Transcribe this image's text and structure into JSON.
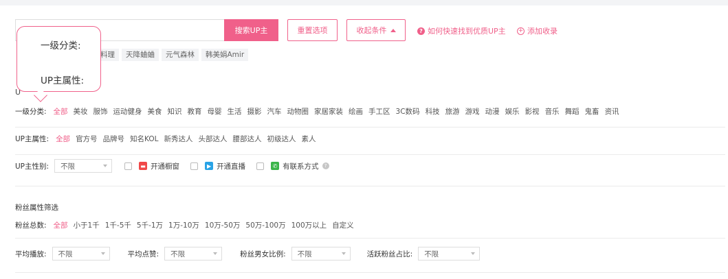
{
  "search": {
    "placeholder": "",
    "button_label": "搜索UP主",
    "reset_label": "重置选项",
    "collapse_label": "收起条件",
    "help_link": "如何快速找到优质UP主",
    "add_link": "添加收录",
    "tags": [
      "料理",
      "天降蛐蛐",
      "元气森林",
      "韩美娟Amir"
    ]
  },
  "tooltip": {
    "line1": "一级分类:",
    "line2": "UP主属性:"
  },
  "up_section_label": "U",
  "categories": {
    "label": "一级分类:",
    "options": [
      "全部",
      "美妆",
      "服饰",
      "运动健身",
      "美食",
      "知识",
      "教育",
      "母婴",
      "生活",
      "摄影",
      "汽车",
      "动物圈",
      "家居家装",
      "绘画",
      "手工区",
      "3C数码",
      "科技",
      "旅游",
      "游戏",
      "动漫",
      "娱乐",
      "影视",
      "音乐",
      "舞蹈",
      "鬼畜",
      "资讯"
    ],
    "active_index": 0
  },
  "attributes": {
    "label": "UP主属性:",
    "options": [
      "全部",
      "官方号",
      "品牌号",
      "知名KOL",
      "新秀达人",
      "头部达人",
      "腰部达人",
      "初级达人",
      "素人"
    ],
    "active_index": 0
  },
  "gender": {
    "label": "UP主性别:",
    "select_value": "不限",
    "checks": [
      "开通橱窗",
      "开通直播",
      "有联系方式"
    ]
  },
  "fans_section": {
    "title": "粉丝属性筛选"
  },
  "fans_total": {
    "label": "粉丝总数:",
    "options": [
      "全部",
      "小于1千",
      "1千-5千",
      "5千-1万",
      "1万-10万",
      "10万-50万",
      "50万-100万",
      "100万以上",
      "自定义"
    ],
    "active_index": 0
  },
  "stats": {
    "avg_play_label": "平均播放:",
    "avg_play_value": "不限",
    "avg_like_label": "平均点赞:",
    "avg_like_value": "不限",
    "gender_ratio_label": "粉丝男女比例:",
    "gender_ratio_value": "不限",
    "active_ratio_label": "活跃粉丝占比:",
    "active_ratio_value": "不限"
  },
  "colors": {
    "accent": "#f0608a",
    "shop_icon": "#f04848",
    "live_icon": "#29a3e6",
    "phone_icon": "#3bb54a"
  }
}
